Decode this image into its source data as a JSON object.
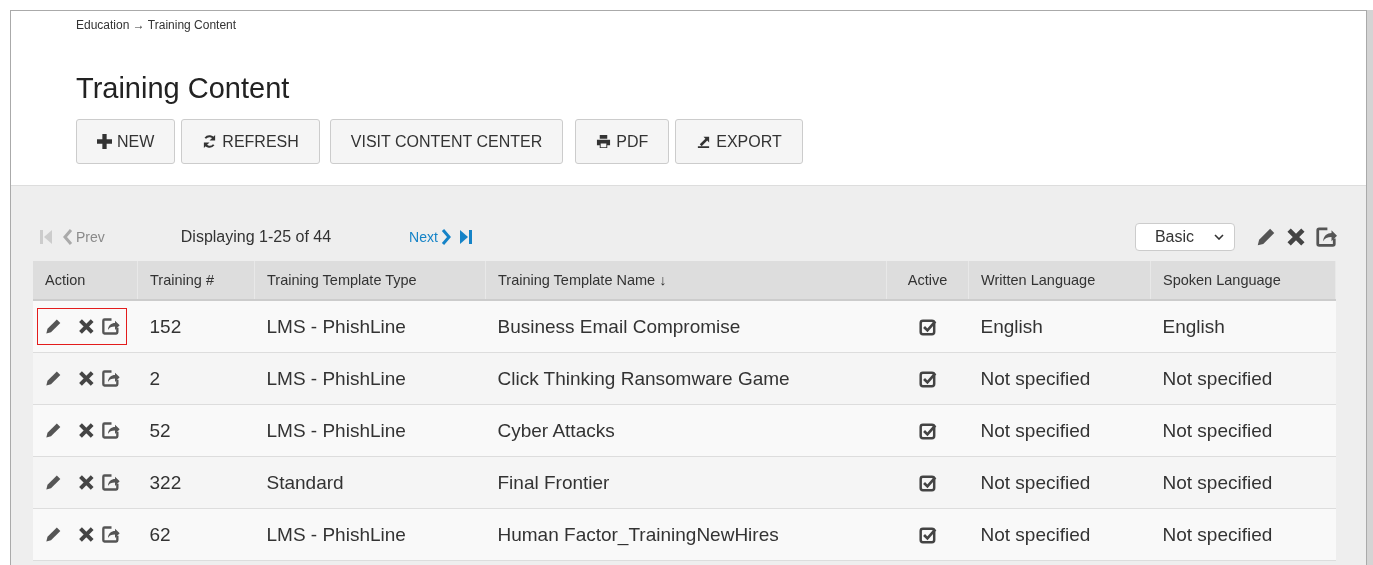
{
  "breadcrumb": "Education → Training Content",
  "title": "Training Content",
  "toolbar": [
    {
      "label": "NEW",
      "kind": "plus"
    },
    {
      "label": "REFRESH",
      "kind": "refresh"
    },
    {
      "label": "VISIT CONTENT CENTER",
      "kind": "none"
    },
    {
      "label": "PDF",
      "kind": "print"
    },
    {
      "label": "EXPORT",
      "kind": "export"
    }
  ],
  "pager": {
    "prev": "Prev",
    "prev_disabled": true,
    "display": "Displaying 1-25 of 44",
    "next": "Next",
    "next_disabled": false
  },
  "view_select": {
    "value": "Basic"
  },
  "table": {
    "columns": [
      "Action",
      "Training #",
      "Training Template Type",
      "Training Template Name ↓",
      "Active",
      "Written Language",
      "Spoken Language"
    ],
    "rows": [
      {
        "number": "152",
        "type": "LMS - PhishLine",
        "name": "Business Email Compromise",
        "active": true,
        "written": "English",
        "spoken": "English",
        "action_highlighted": true
      },
      {
        "number": "2",
        "type": "LMS - PhishLine",
        "name": "Click Thinking Ransomware Game",
        "active": true,
        "written": "Not specified",
        "spoken": "Not specified",
        "action_highlighted": false
      },
      {
        "number": "52",
        "type": "LMS - PhishLine",
        "name": "Cyber Attacks",
        "active": true,
        "written": "Not specified",
        "spoken": "Not specified",
        "action_highlighted": false
      },
      {
        "number": "322",
        "type": "Standard",
        "name": "Final Frontier",
        "active": true,
        "written": "Not specified",
        "spoken": "Not specified",
        "action_highlighted": false
      },
      {
        "number": "62",
        "type": "LMS - PhishLine",
        "name": "Human Factor_TrainingNewHires",
        "active": true,
        "written": "Not specified",
        "spoken": "Not specified",
        "action_highlighted": false
      }
    ]
  }
}
